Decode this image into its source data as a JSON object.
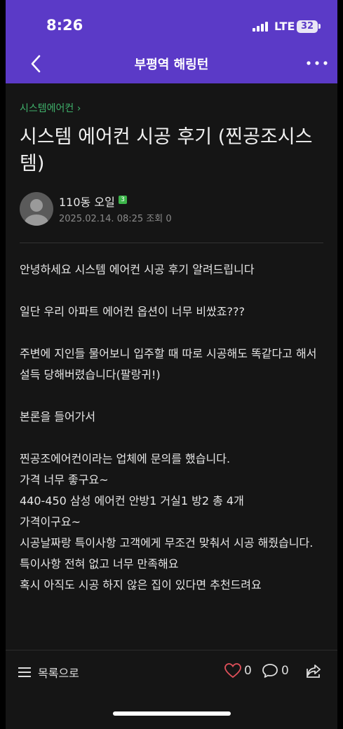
{
  "status": {
    "time": "8:26",
    "network": "LTE",
    "battery": "32"
  },
  "header": {
    "title": "부평역 해링턴"
  },
  "post": {
    "category": "시스템에어컨 ›",
    "title": "시스템 에어컨 시공 후기 (찐공조시스템)",
    "author": "110동 오일",
    "level": "3",
    "date": "2025.02.14. 08:25",
    "views": "조회 0",
    "body": [
      "안녕하세요 시스템 에어컨 시공 후기 알려드립니다",
      "",
      "일단 우리 아파트 에어컨 옵션이 너무 비쌌죠???",
      "",
      "주변에 지인들 물어보니 입주할 때 따로 시공해도 똑같다고 해서 설득 당해버렸습니다(팔랑귀!)",
      "",
      "본론을 들어가서",
      "",
      "찐공조에어컨이라는 업체에 문의를 했습니다.",
      "가격 너무 좋구요~",
      "440-450 삼성 에어컨 안방1 거실1 방2 총 4개",
      "가격이구요~",
      "시공날짜랑 특이사항 고객에게 무조건 맞춰서 시공 해줬습니다.",
      "특이사항 전혀 없고 너무 만족해요",
      "혹시 아직도 시공 하지 않은 집이 있다면 추천드려요"
    ]
  },
  "bottom": {
    "list_label": "목록으로",
    "likes": "0",
    "comments": "0"
  }
}
